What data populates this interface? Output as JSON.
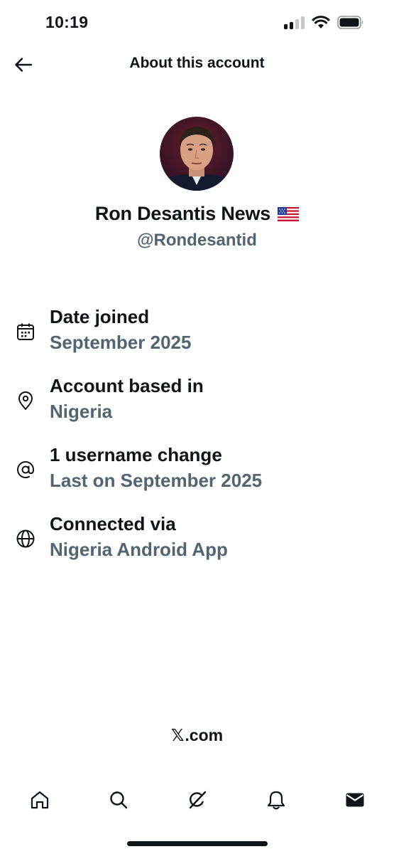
{
  "status_bar": {
    "time": "10:19",
    "icons": [
      "signal-icon",
      "wifi-icon",
      "battery-icon"
    ]
  },
  "header": {
    "title": "About this account",
    "back_icon": "arrow-left-icon"
  },
  "profile": {
    "display_name": "Ron Desantis News",
    "flag_icon": "us-flag-icon",
    "handle": "@Rondesantid"
  },
  "info": [
    {
      "icon": "calendar-icon",
      "title": "Date joined",
      "value": "September 2025"
    },
    {
      "icon": "location-pin-icon",
      "title": "Account based in",
      "value": "Nigeria"
    },
    {
      "icon": "at-sign-icon",
      "title": "1 username change",
      "value": "Last on September 2025"
    },
    {
      "icon": "globe-icon",
      "title": "Connected via",
      "value": "Nigeria Android App"
    }
  ],
  "footer": {
    "brand_mark": "𝕏",
    "brand_suffix": ".com"
  },
  "bottom_nav": [
    "home-icon",
    "search-icon",
    "grok-icon",
    "notifications-icon",
    "messages-icon"
  ],
  "colors": {
    "primary_text": "#0f1419",
    "secondary_text": "#536471",
    "background": "#ffffff"
  }
}
